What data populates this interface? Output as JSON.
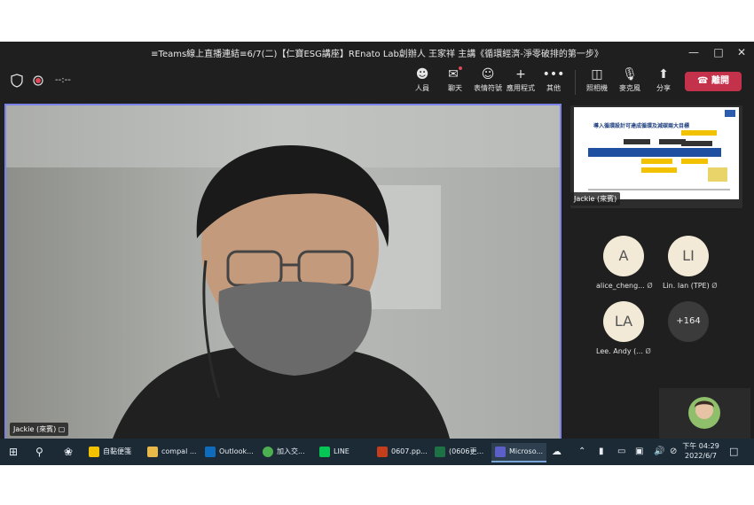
{
  "window": {
    "title": "≡Teams線上直播連結≡6/7(二)【仁寶ESG講座】REnato Lab創辦人 王家祥 主講《循環經濟-淨零破排的第一步》",
    "minimize_icon": "minimize-icon",
    "maximize_icon": "maximize-icon",
    "close_icon": "close-icon"
  },
  "toolbar": {
    "timer": "--:--",
    "people": "人員",
    "chat": "聊天",
    "reactions": "表情符號",
    "apps": "應用程式",
    "more": "其他",
    "camera": "照相機",
    "mic": "麥克風",
    "share": "分享",
    "leave": "離開"
  },
  "stage": {
    "speaker_name": "Jackie (來賓)"
  },
  "shared_content": {
    "slide_title": "導入循環設計可達成循環及減碳兩大目標",
    "presenter": "Jackie (來賓)"
  },
  "participants": [
    {
      "initials": "A",
      "name": "alice_cheng..."
    },
    {
      "initials": "LI",
      "name": "Lin. Ian (TPE)"
    },
    {
      "initials": "LA",
      "name": "Lee. Andy (..."
    }
  ],
  "more_participants": "+164",
  "taskbar": {
    "items": [
      {
        "label": "自黏便箋",
        "color": "#f2c200"
      },
      {
        "label": "compal ...",
        "color": "#e8b84a"
      },
      {
        "label": "Outlook...",
        "color": "#0f6cbd"
      },
      {
        "label": "加入交...",
        "color": "#4caf50"
      },
      {
        "label": "LINE",
        "color": "#06c755"
      },
      {
        "label": "0607.pp...",
        "color": "#c43e1c"
      },
      {
        "label": "(0606更...",
        "color": "#1e7145"
      },
      {
        "label": "Microso...",
        "color": "#5b5fc7"
      }
    ],
    "time": "下午 04:29",
    "date": "2022/6/7"
  }
}
